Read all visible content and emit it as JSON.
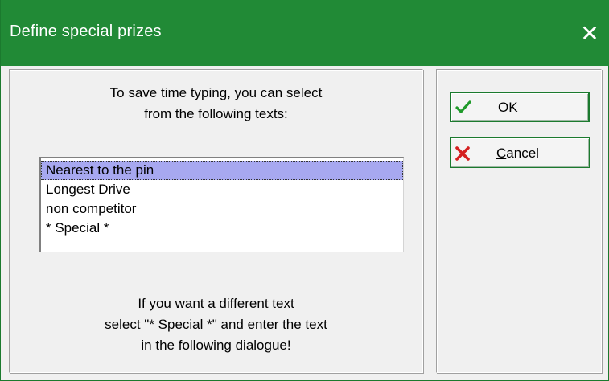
{
  "window": {
    "title": "Define special prizes",
    "close_glyph": "✕"
  },
  "intro": {
    "line1": "To save time typing, you can select",
    "line2": "from the following texts:"
  },
  "list": {
    "items": [
      {
        "label": "Nearest to the pin",
        "selected": true
      },
      {
        "label": "Longest Drive",
        "selected": false
      },
      {
        "label": "non competitor",
        "selected": false
      },
      {
        "label": "* Special *",
        "selected": false
      }
    ]
  },
  "outro": {
    "line1": "If you want a different text",
    "line2": "select \"* Special *\" and enter the text",
    "line3": "in the following dialogue!"
  },
  "buttons": {
    "ok": {
      "mnemonic": "O",
      "rest": "K",
      "icon": "checkmark-icon"
    },
    "cancel": {
      "mnemonic": "C",
      "rest": "ancel",
      "icon": "red-x-icon"
    }
  },
  "colors": {
    "titlebar": "#218a36",
    "selection": "#a7a8f0",
    "check": "#1f9a2a",
    "cross": "#d42020"
  }
}
